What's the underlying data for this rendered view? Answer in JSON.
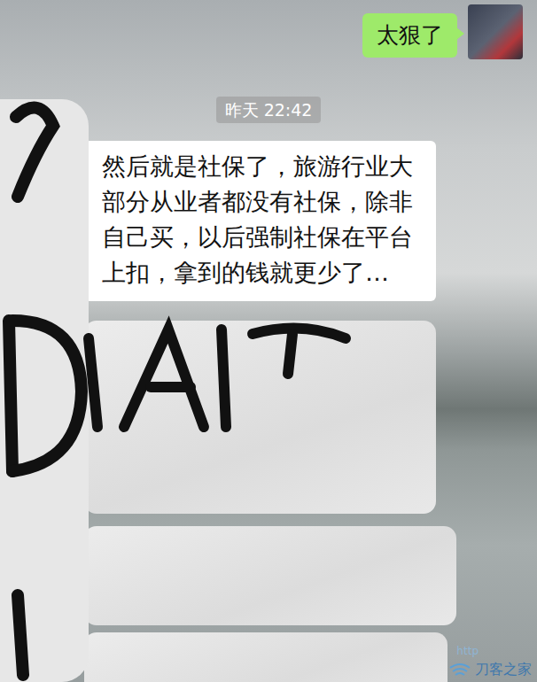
{
  "messages": [
    {
      "kind": "sent",
      "text": "太狠了"
    },
    {
      "kind": "time",
      "text": "昨天 22:42"
    },
    {
      "kind": "received",
      "text": "然后就是社保了，旅游行业大部分从业者都没有社保，除非自己买，以后强制社保在平台上扣，拿到的钱就更少了…"
    },
    {
      "kind": "redacted"
    },
    {
      "kind": "redacted"
    },
    {
      "kind": "redacted"
    }
  ],
  "watermark": {
    "url": "http",
    "name": "刀客之家"
  }
}
